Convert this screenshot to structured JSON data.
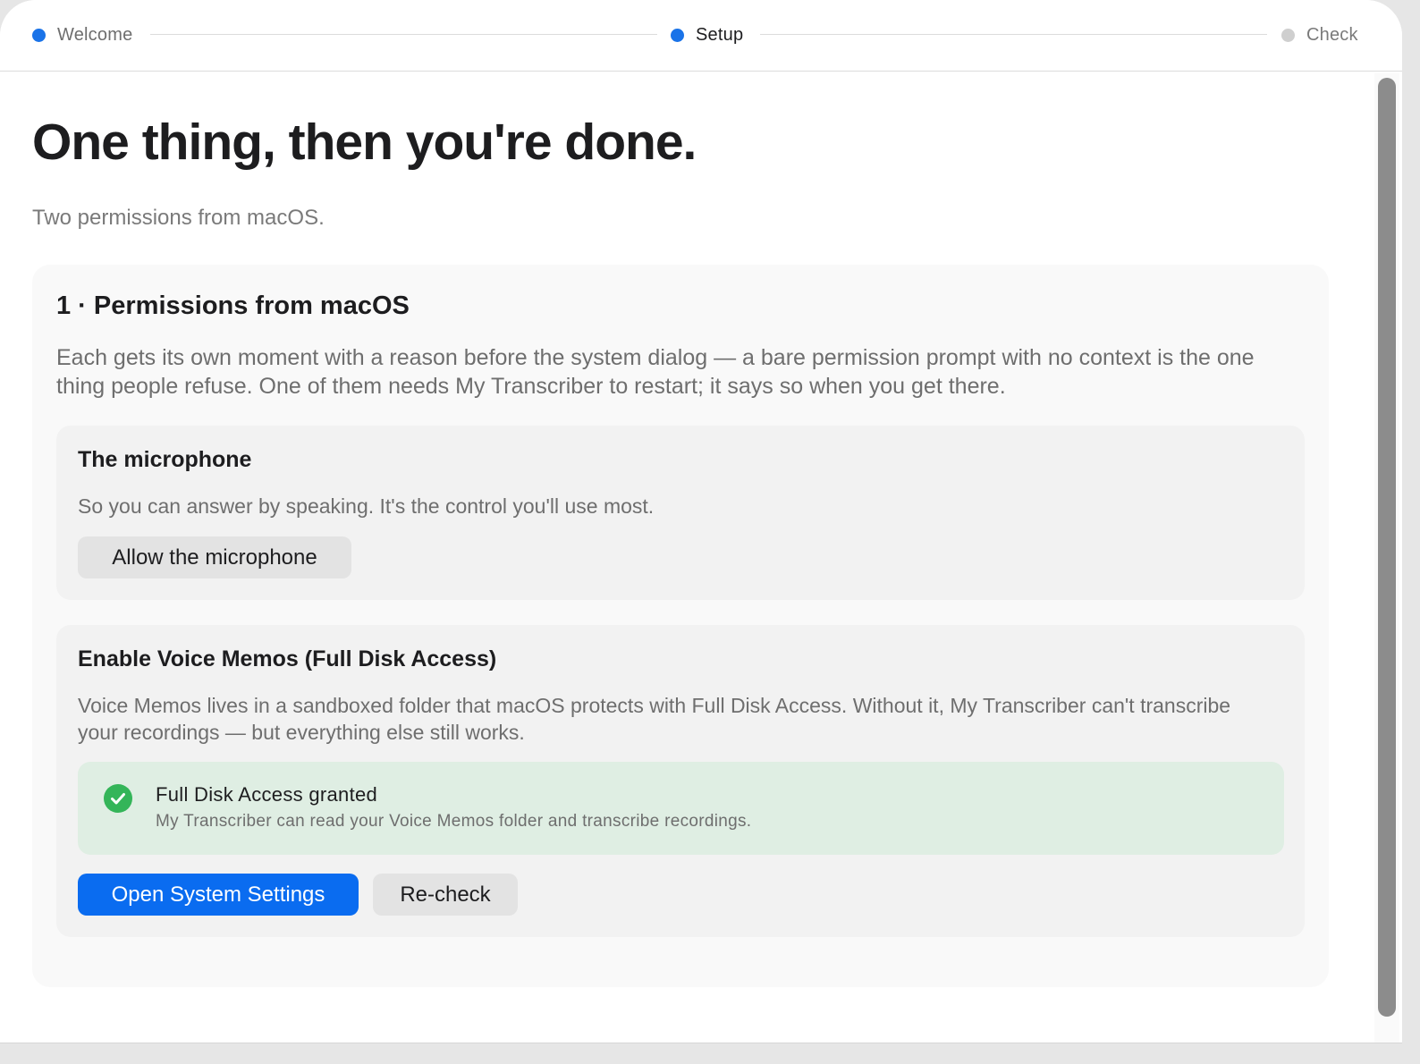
{
  "stepper": {
    "steps": [
      {
        "label": "Welcome",
        "state": "done"
      },
      {
        "label": "Setup",
        "state": "current"
      },
      {
        "label": "Check",
        "state": "pending"
      }
    ]
  },
  "header": {
    "title": "One thing, then you're done.",
    "subtitle": "Two permissions from macOS."
  },
  "section": {
    "title": "1 · Permissions from macOS",
    "description": "Each gets its own moment with a reason before the system dialog — a bare permission prompt with no context is the one thing people refuse. One of them needs My Transcriber to restart; it says so when you get there."
  },
  "microphone": {
    "title": "The microphone",
    "description": "So you can answer by speaking. It's the control you'll use most.",
    "button_label": "Allow the microphone"
  },
  "full_disk": {
    "title": "Enable Voice Memos (Full Disk Access)",
    "description": "Voice Memos lives in a sandboxed folder that macOS protects with Full Disk Access. Without it, My Transcriber can't transcribe your recordings — but everything else still works.",
    "status": {
      "icon": "checkmark-circle-icon",
      "title": "Full Disk Access granted",
      "detail": "My Transcriber can read your Voice Memos folder and transcribe recordings."
    },
    "primary_button_label": "Open System Settings",
    "secondary_button_label": "Re-check"
  },
  "colors": {
    "accent": "#0a6cf0",
    "step_active": "#1a73e8",
    "step_pending": "#cfcfcf",
    "success": "#34b559",
    "success_background": "#dfeee3"
  }
}
